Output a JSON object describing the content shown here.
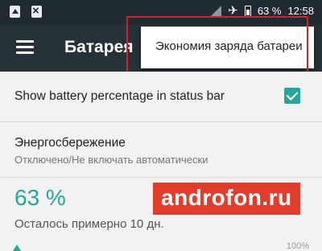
{
  "status_bar": {
    "icons_left": [
      "image-notification-icon",
      "sim-card-icon"
    ],
    "icons_right": [
      "no-signal-icon",
      "airplane-icon",
      "battery-icon"
    ],
    "battery_text": "63 %",
    "time": "12:58"
  },
  "app_bar": {
    "menu_icon": "hamburger-icon",
    "title": "Батарея"
  },
  "popup_menu": {
    "items": [
      {
        "label": "Экономия заряда батареи"
      }
    ]
  },
  "settings": {
    "show_percentage": {
      "label": "Show battery percentage in status bar",
      "checked": true
    },
    "power_saving": {
      "title": "Энергосбережение",
      "subtitle": "Отключено/Не включать автоматически"
    }
  },
  "battery": {
    "level": "63 %",
    "remaining": "Осталось примерно 10 дн.",
    "graph_max_label": "100%"
  },
  "watermark": "androfon.ru",
  "colors": {
    "accent": "#26a69a",
    "appbar": "#263238",
    "highlight": "#d0212d",
    "watermark": "#e23d2c"
  }
}
